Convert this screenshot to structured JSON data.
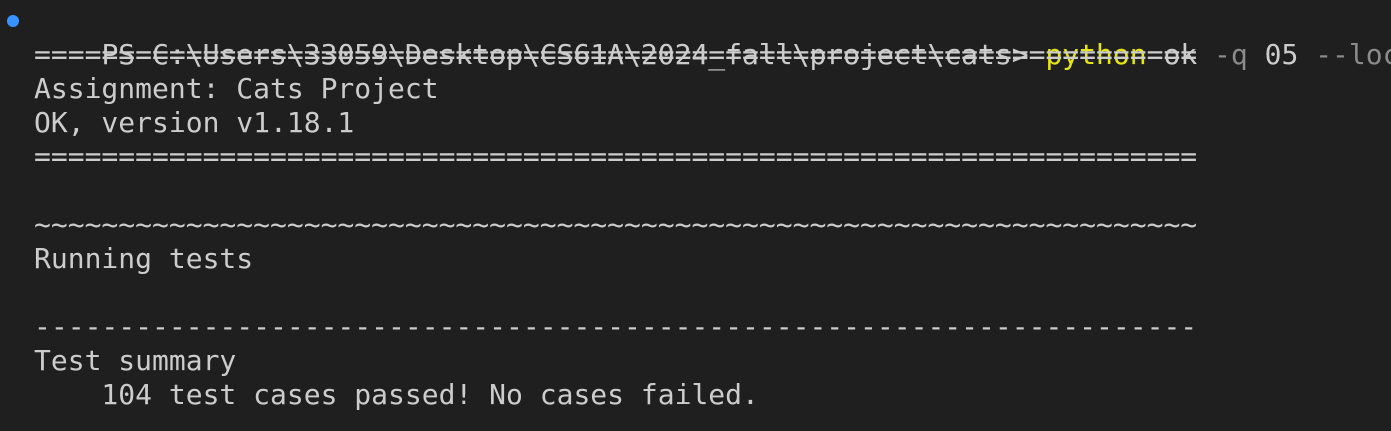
{
  "terminal": {
    "prompt": "PS C:\\Users\\33059\\Desktop\\CS61A\\2024_fall\\project\\cats> ",
    "command": {
      "program": "python",
      "arg1": "ok",
      "flag1": "-q",
      "arg2": "05",
      "flag2": "--local"
    },
    "lines": {
      "sep1": "=====================================================================",
      "assignment": "Assignment: Cats Project",
      "version": "OK, version v1.18.1",
      "sep2": "=====================================================================",
      "tilde": "~~~~~~~~~~~~~~~~~~~~~~~~~~~~~~~~~~~~~~~~~~~~~~~~~~~~~~~~~~~~~~~~~~~~~",
      "running": "Running tests",
      "dash": "---------------------------------------------------------------------",
      "summary": "Test summary",
      "result": "    104 test cases passed! No cases failed."
    },
    "colors": {
      "background": "#1f1f1f",
      "text": "#cccccc",
      "program": "#e5e510",
      "flag": "#8b8b8b",
      "prompt_dot": "#3794ff"
    }
  }
}
